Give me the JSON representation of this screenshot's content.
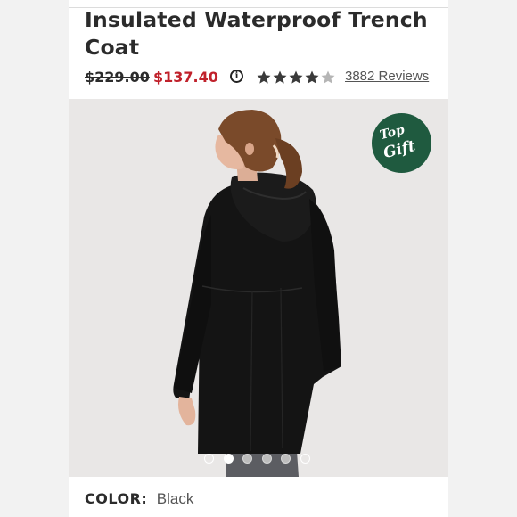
{
  "product": {
    "title": "Insulated Waterproof Trench Coat",
    "original_price": "$229.00",
    "sale_price": "$137.40",
    "rating_stars": 4,
    "rating_max": 5,
    "reviews_label": "3882 Reviews"
  },
  "badge": {
    "line1": "Top",
    "line2": "Gift"
  },
  "carousel": {
    "total": 6,
    "active_index": 1
  },
  "color": {
    "label": "COLOR:",
    "value": "Black"
  },
  "icons": {
    "info": "info-icon",
    "star": "star-icon"
  },
  "colors": {
    "sale": "#c0212b",
    "badge": "#1f5a3f",
    "star_filled": "#3a3a3a",
    "star_empty": "#b5b5b5"
  }
}
